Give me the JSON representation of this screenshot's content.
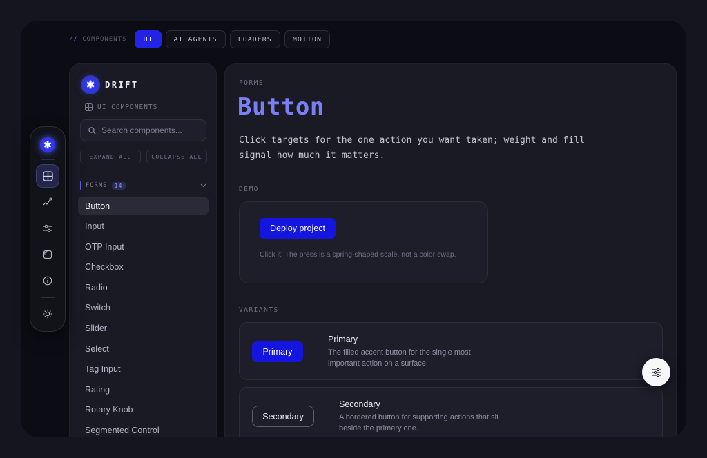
{
  "topbar": {
    "crumb_slashes": "//",
    "crumb": "COMPONENTS",
    "tabs": [
      {
        "label": "UI",
        "active": true
      },
      {
        "label": "AI AGENTS"
      },
      {
        "label": "LOADERS"
      },
      {
        "label": "MOTION"
      }
    ]
  },
  "sidebar": {
    "brand": "DRIFT",
    "logo_glyph": "✱",
    "subtitle": "UI COMPONENTS",
    "search_placeholder": "Search components...",
    "expand_all": "EXPAND ALL",
    "collapse_all": "COLLAPSE ALL",
    "group": {
      "label": "FORMS",
      "count": "14"
    },
    "items": [
      "Button",
      "Input",
      "OTP Input",
      "Checkbox",
      "Radio",
      "Switch",
      "Slider",
      "Select",
      "Tag Input",
      "Rating",
      "Rotary Knob",
      "Segmented Control"
    ],
    "active_item": "Button"
  },
  "main": {
    "eyebrow": "FORMS",
    "title": "Button",
    "lede": "Click targets for the one action you want taken; weight and fill signal how much it matters.",
    "demo_label": "DEMO",
    "demo_button": "Deploy project",
    "demo_note": "Click it. The press is a spring-shaped scale, not a color swap.",
    "variants_label": "VARIANTS",
    "variants": [
      {
        "button": "Primary",
        "title": "Primary",
        "desc": "The filled accent button for the single most important action on a surface."
      },
      {
        "button": "Secondary",
        "title": "Secondary",
        "desc": "A bordered button for supporting actions that sit beside the primary one."
      }
    ]
  },
  "rail": {
    "icons": [
      "logo-icon",
      "grid-icon",
      "chart-icon",
      "sliders-icon",
      "layers-icon",
      "info-icon",
      "sun-icon"
    ]
  },
  "colors": {
    "accent": "#2323e6",
    "title_accent": "#7b7ff5",
    "background": "#0c0d14"
  }
}
